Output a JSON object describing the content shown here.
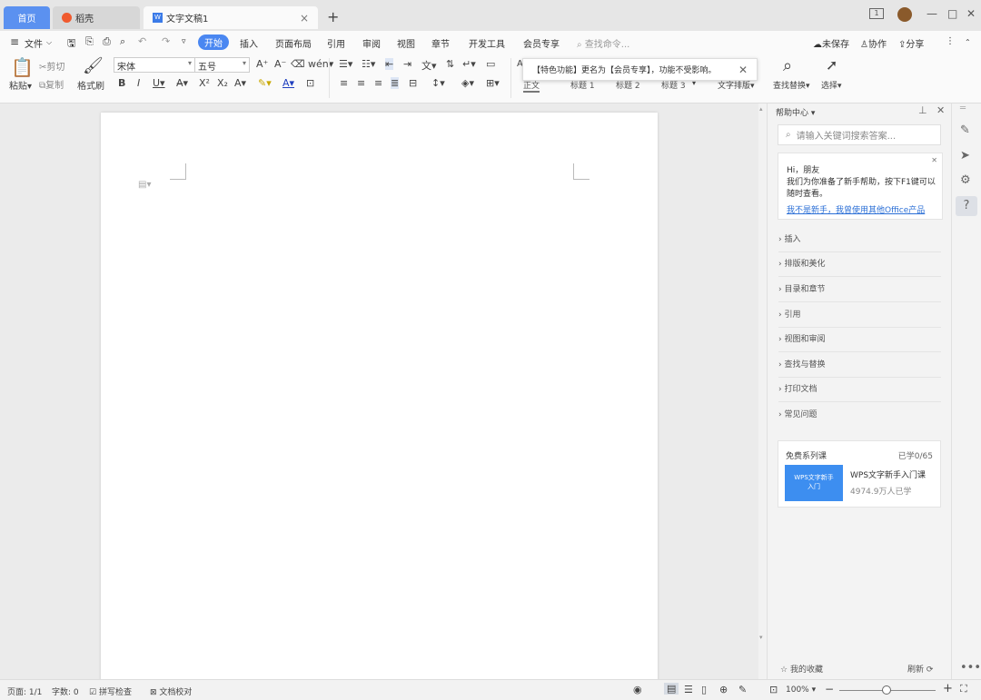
{
  "tabs": {
    "home": "首页",
    "docer": "稻壳",
    "doc": "文字文稿1"
  },
  "menu": {
    "file": "文件",
    "items": [
      "开始",
      "插入",
      "页面布局",
      "引用",
      "审阅",
      "视图",
      "章节",
      "开发工具",
      "会员专享"
    ],
    "search_placeholder": "查找命令...",
    "unsaved": "未保存",
    "collab": "协作",
    "share": "分享"
  },
  "ribbon": {
    "paste": "粘贴",
    "cut": "剪切",
    "copy": "复制",
    "format_painter": "格式刷",
    "font": "宋体",
    "size": "五号",
    "styles": [
      "正文",
      "标题 1",
      "标题 2",
      "标题 3"
    ],
    "text_layout": "文字排版",
    "find_replace": "查找替换",
    "select": "选择"
  },
  "tooltip": {
    "text": "【特色功能】更名为【会员专享】，功能不受影响。"
  },
  "help_panel": {
    "title": "帮助中心",
    "search_placeholder": "请输入关键词搜索答案...",
    "greeting": "Hi，朋友",
    "body": "我们为你准备了新手帮助，按下F1键可以随时查看。",
    "link": "我不是新手，我曾使用其他Office产品",
    "items": [
      "插入",
      "排版和美化",
      "目录和章节",
      "引用",
      "视图和审阅",
      "查找与替换",
      "打印文档",
      "常见问题"
    ],
    "course_header": "免费系列课",
    "course_progress": "已学0/65",
    "course_thumb": "WPS文字新手入门",
    "course_title": "WPS文字新手入门课",
    "course_learners": "4974.9万人已学",
    "favorites": "我的收藏",
    "refresh": "刷新"
  },
  "status": {
    "page": "页面: 1/1",
    "words": "字数: 0",
    "spell": "拼写检查",
    "proof": "文档校对",
    "zoom": "100%"
  },
  "colors": {
    "accent": "#4a87f1",
    "link": "#2b6fd6"
  }
}
